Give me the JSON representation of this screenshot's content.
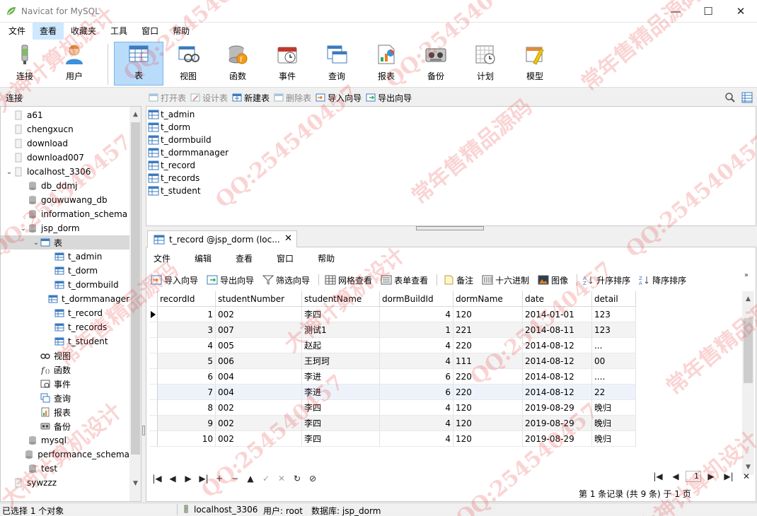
{
  "window": {
    "title": "Navicat for MySQL",
    "minimize": "—",
    "maximize": "☐",
    "close": "✕"
  },
  "menubar": [
    "文件",
    "查看",
    "收藏夹",
    "工具",
    "窗口",
    "帮助"
  ],
  "toolbar": [
    {
      "label": "连接",
      "icon": "plug-icon"
    },
    {
      "label": "用户",
      "icon": "user-icon"
    },
    {
      "label": "表",
      "icon": "table-icon"
    },
    {
      "label": "视图",
      "icon": "view-icon"
    },
    {
      "label": "函数",
      "icon": "function-icon"
    },
    {
      "label": "事件",
      "icon": "event-clock-icon"
    },
    {
      "label": "查询",
      "icon": "query-icon"
    },
    {
      "label": "报表",
      "icon": "report-icon"
    },
    {
      "label": "备份",
      "icon": "backup-tape-icon"
    },
    {
      "label": "计划",
      "icon": "schedule-icon"
    },
    {
      "label": "模型",
      "icon": "model-icon"
    }
  ],
  "left_header": "连接",
  "object_toolbar": {
    "open": "打开表",
    "design": "设计表",
    "new": "新建表",
    "delete": "删除表",
    "import": "导入向导",
    "export": "导出向导"
  },
  "tree": [
    {
      "label": "a61",
      "level": 0,
      "icon": "connection-icon"
    },
    {
      "label": "chengxucn",
      "level": 0,
      "icon": "connection-icon"
    },
    {
      "label": "download",
      "level": 0,
      "icon": "connection-icon"
    },
    {
      "label": "download007",
      "level": 0,
      "icon": "connection-icon"
    },
    {
      "label": "localhost_3306",
      "level": 0,
      "icon": "connection-icon",
      "expanded": true
    },
    {
      "label": "db_ddmj",
      "level": 1,
      "icon": "database-icon"
    },
    {
      "label": "gouwuwang_db",
      "level": 1,
      "icon": "database-icon"
    },
    {
      "label": "information_schema",
      "level": 1,
      "icon": "database-icon"
    },
    {
      "label": "jsp_dorm",
      "level": 1,
      "icon": "database-icon",
      "expanded": true
    },
    {
      "label": "表",
      "level": 2,
      "icon": "table-folder-icon",
      "expanded": true,
      "selected": true
    },
    {
      "label": "t_admin",
      "level": 3,
      "icon": "table-icon"
    },
    {
      "label": "t_dorm",
      "level": 3,
      "icon": "table-icon"
    },
    {
      "label": "t_dormbuild",
      "level": 3,
      "icon": "table-icon"
    },
    {
      "label": "t_dormmanager",
      "level": 3,
      "icon": "table-icon"
    },
    {
      "label": "t_record",
      "level": 3,
      "icon": "table-icon"
    },
    {
      "label": "t_records",
      "level": 3,
      "icon": "table-icon"
    },
    {
      "label": "t_student",
      "level": 3,
      "icon": "table-icon"
    },
    {
      "label": "视图",
      "level": 2,
      "icon": "view-icon"
    },
    {
      "label": "函数",
      "level": 2,
      "icon": "function-icon"
    },
    {
      "label": "事件",
      "level": 2,
      "icon": "event-icon"
    },
    {
      "label": "查询",
      "level": 2,
      "icon": "query-icon"
    },
    {
      "label": "报表",
      "level": 2,
      "icon": "report-icon"
    },
    {
      "label": "备份",
      "level": 2,
      "icon": "backup-icon"
    },
    {
      "label": "mysql",
      "level": 1,
      "icon": "database-icon"
    },
    {
      "label": "performance_schema",
      "level": 1,
      "icon": "database-icon"
    },
    {
      "label": "test",
      "level": 1,
      "icon": "database-icon"
    },
    {
      "label": "sywzzz",
      "level": 0,
      "icon": "connection-icon"
    }
  ],
  "objects": [
    "t_admin",
    "t_dorm",
    "t_dormbuild",
    "t_dormmanager",
    "t_record",
    "t_records",
    "t_student"
  ],
  "editor_tab": {
    "label": "t_record @jsp_dorm (loc...",
    "close": "✕"
  },
  "editor_menu": [
    "文件",
    "编辑",
    "查看",
    "窗口",
    "帮助"
  ],
  "editor_toolbar": {
    "import": "导入向导",
    "export": "导出向导",
    "filter": "筛选向导",
    "grid_view": "网格查看",
    "form_view": "表单查看",
    "memo": "备注",
    "hex": "十六进制",
    "image": "图像",
    "sort_asc": "升序排序",
    "sort_desc": "降序排序",
    "more": "»"
  },
  "grid": {
    "columns": [
      "recordId",
      "studentNumber",
      "studentName",
      "dormBuildId",
      "dormName",
      "date",
      "detail"
    ],
    "rows": [
      [
        "1",
        "002",
        "李四",
        "4",
        "120",
        "2014-01-01",
        "123"
      ],
      [
        "3",
        "007",
        "测试1",
        "1",
        "221",
        "2014-08-11",
        "123"
      ],
      [
        "4",
        "005",
        "赵起",
        "4",
        "220",
        "2014-08-12",
        "..."
      ],
      [
        "5",
        "006",
        "王珂珂",
        "4",
        "111",
        "2014-08-12",
        "00"
      ],
      [
        "6",
        "004",
        "李进",
        "6",
        "220",
        "2014-08-12",
        "...."
      ],
      [
        "7",
        "004",
        "李进",
        "6",
        "220",
        "2014-08-12",
        "22"
      ],
      [
        "8",
        "002",
        "李四",
        "4",
        "120",
        "2019-08-29",
        "晚归"
      ],
      [
        "9",
        "002",
        "李四",
        "4",
        "120",
        "2019-08-29",
        "晚归"
      ],
      [
        "10",
        "002",
        "李四",
        "4",
        "120",
        "2019-08-29",
        "晚归"
      ]
    ]
  },
  "nav": {
    "first": "|◀",
    "prev": "◀",
    "next": "▶",
    "last": "▶|",
    "add": "+",
    "remove": "−",
    "up": "▲",
    "apply": "✓",
    "cancel": "✕",
    "refresh": "↻",
    "stop": "⊘",
    "page": "1"
  },
  "record_info": "第 1 条记录 (共 9 条) 于 1 页",
  "status": {
    "selection": "已选择 1 个对象",
    "connection": "localhost_3306",
    "user": "用户: root",
    "database": "数据库: jsp_dorm"
  },
  "watermark": {
    "text1": "QQ:254540457",
    "text2": "大神计算机设计",
    "text3": "常年售精品源码"
  },
  "colors": {
    "active_tool": "#b9dcfb",
    "selection": "#d9d9d9",
    "watermark": "#e63c3c"
  }
}
